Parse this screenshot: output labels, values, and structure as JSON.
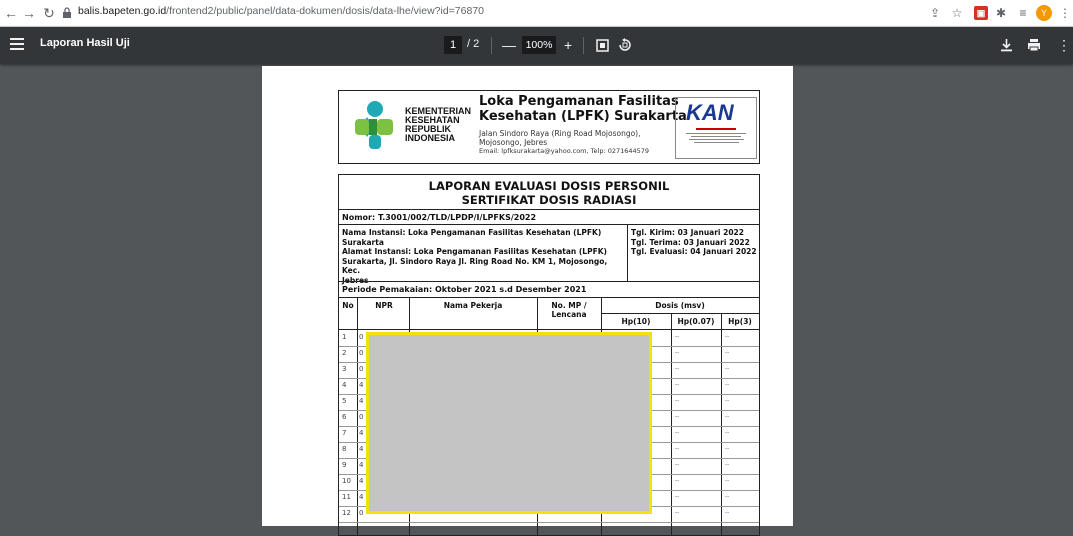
{
  "browser": {
    "url_host": "balis.bapeten.go.id",
    "url_path": "/frontend2/public/panel/data-dokumen/dosis/data-lhe/view?id=76870",
    "avatar_initial": "Y"
  },
  "pdf_toolbar": {
    "title": "Laporan Hasil Uji",
    "current_page": "1",
    "total_pages": "/ 2",
    "zoom": "100%",
    "zoom_out": "—",
    "zoom_in": "+"
  },
  "letterhead": {
    "ministry_lines": [
      "KEMENTERIAN",
      "KESEHATAN",
      "REPUBLIK",
      "INDONESIA"
    ],
    "org_name_1": "Loka Pengamanan Fasilitas",
    "org_name_2": "Kesehatan (LPFK) Surakarta",
    "address_1": "Jalan Sindoro Raya (Ring Road Mojosongo),",
    "address_2": "Mojosongo, Jebres",
    "email_line": "Email: lpfksurakarta@yahoo.com, Telp: 0271644579",
    "kan_text": "KAN"
  },
  "report": {
    "title_1": "LAPORAN EVALUASI DOSIS PERSONIL",
    "title_2": "SERTIFIKAT DOSIS RADIASI",
    "nomor": "Nomor: T.3001/002/TLD/LPDP/I/LPFKS/2022",
    "instansi_1": "Nama Instansi: Loka Pengamanan Fasilitas Kesehatan (LPFK)",
    "instansi_2": "Surakarta",
    "alamat_1": "Alamat Instansi: Loka Pengamanan Fasilitas Kesehatan (LPFK)",
    "alamat_2": "Surakarta, Jl. Sindoro Raya Jl. Ring Road No. KM 1, Mojosongo, Kec.",
    "alamat_3": "Jebres",
    "tgl_kirim": "Tgl. Kirim: 03 Januari 2022",
    "tgl_terima": "Tgl. Terima: 03 Januari 2022",
    "tgl_evaluasi": "Tgl. Evaluasi: 04 Januari 2022",
    "periode": "Periode Pemakaian: Oktober 2021 s.d Desember 2021",
    "headers": {
      "no": "No",
      "npr": "NPR",
      "nama": "Nama Pekerja",
      "mp_1": "No. MP /",
      "mp_2": "Lencana",
      "dosis": "Dosis (msv)",
      "hp10": "Hp(10)",
      "hp007": "Hp(0.07)",
      "hp3": "Hp(3)"
    },
    "rows": [
      {
        "no": "1",
        "npr": "0"
      },
      {
        "no": "2",
        "npr": "0"
      },
      {
        "no": "3",
        "npr": "0"
      },
      {
        "no": "4",
        "npr": "4"
      },
      {
        "no": "5",
        "npr": "4"
      },
      {
        "no": "6",
        "npr": "0"
      },
      {
        "no": "7",
        "npr": "4"
      },
      {
        "no": "8",
        "npr": "4"
      },
      {
        "no": "9",
        "npr": "4"
      },
      {
        "no": "10",
        "npr": "4"
      },
      {
        "no": "11",
        "npr": "4"
      },
      {
        "no": "12",
        "npr": "0"
      }
    ],
    "dash": "--"
  }
}
